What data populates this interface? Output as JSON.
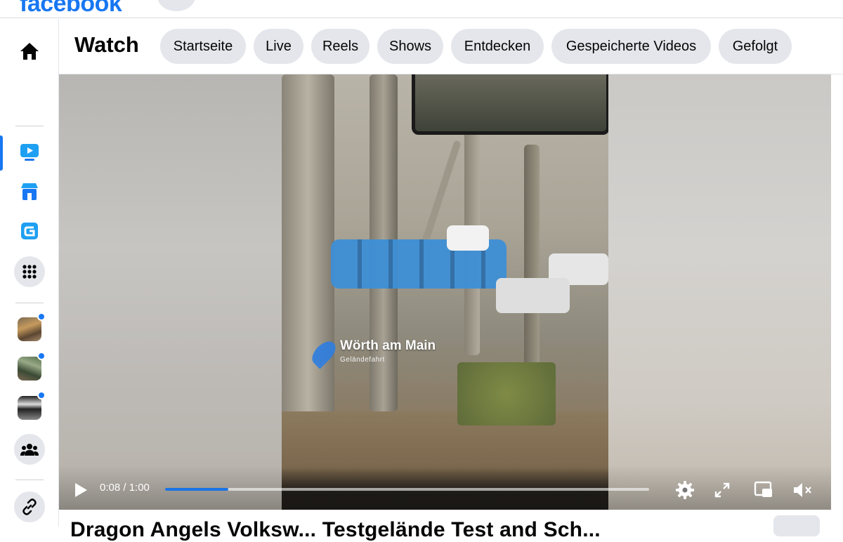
{
  "brand": {
    "logo_text": "facebook"
  },
  "watch": {
    "title": "Watch",
    "tabs": [
      {
        "label": "Startseite"
      },
      {
        "label": "Live"
      },
      {
        "label": "Reels"
      },
      {
        "label": "Shows"
      },
      {
        "label": "Entdecken"
      },
      {
        "label": "Gespeicherte Videos"
      },
      {
        "label": "Gefolgt"
      }
    ]
  },
  "sidebar": {
    "items": [
      {
        "name": "home",
        "icon": "home-icon"
      },
      {
        "name": "watch",
        "icon": "watch-icon",
        "active": true
      },
      {
        "name": "marketplace",
        "icon": "marketplace-icon"
      },
      {
        "name": "gaming",
        "icon": "gaming-icon"
      },
      {
        "name": "menu",
        "icon": "grid-icon"
      },
      {
        "name": "group-1",
        "icon": "group-avatar",
        "unread": true
      },
      {
        "name": "group-2",
        "icon": "group-avatar",
        "unread": true
      },
      {
        "name": "group-3",
        "icon": "group-avatar",
        "unread": true
      },
      {
        "name": "groups",
        "icon": "groups-icon"
      },
      {
        "name": "link",
        "icon": "link-icon"
      }
    ]
  },
  "video": {
    "overlay_location": "Wörth am Main",
    "overlay_subtitle": "Geländefahrt",
    "time": "0:08 / 1:00",
    "progress": 0.13,
    "controls": [
      "play-icon",
      "settings-icon",
      "fullscreen-expand-icon",
      "picture-in-picture-icon",
      "mute-icon"
    ]
  },
  "post": {
    "title": "Dragon Angels Volksw... Testgelände Test and Sch..."
  },
  "colors": {
    "accent": "#1877f2",
    "chip_bg": "#e4e6eb",
    "progress_fill": "#1b74e4"
  }
}
